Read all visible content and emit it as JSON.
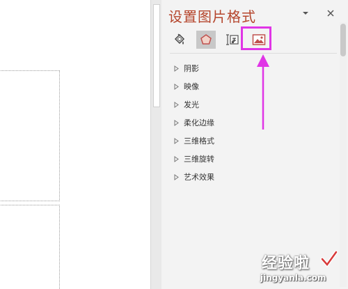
{
  "pane": {
    "title": "设置图片格式",
    "title_color": "#b5452c",
    "dropdown_icon": "chevron-down-icon",
    "close_icon": "close-icon",
    "tabs": [
      {
        "name": "fill-line",
        "icon": "paint-bucket-icon",
        "selected": false
      },
      {
        "name": "effects",
        "icon": "pentagon-icon",
        "selected": true
      },
      {
        "name": "size-properties",
        "icon": "size-icon",
        "selected": false
      },
      {
        "name": "picture",
        "icon": "picture-icon",
        "selected": false,
        "highlighted": true
      }
    ],
    "sections": [
      {
        "label": "阴影"
      },
      {
        "label": "映像"
      },
      {
        "label": "发光"
      },
      {
        "label": "柔化边缘"
      },
      {
        "label": "三维格式"
      },
      {
        "label": "三维旋转"
      },
      {
        "label": "艺术效果"
      }
    ]
  },
  "annotation": {
    "color": "#e035e6"
  },
  "watermark": {
    "main": "经验啦",
    "url": "jingyanla.com"
  }
}
